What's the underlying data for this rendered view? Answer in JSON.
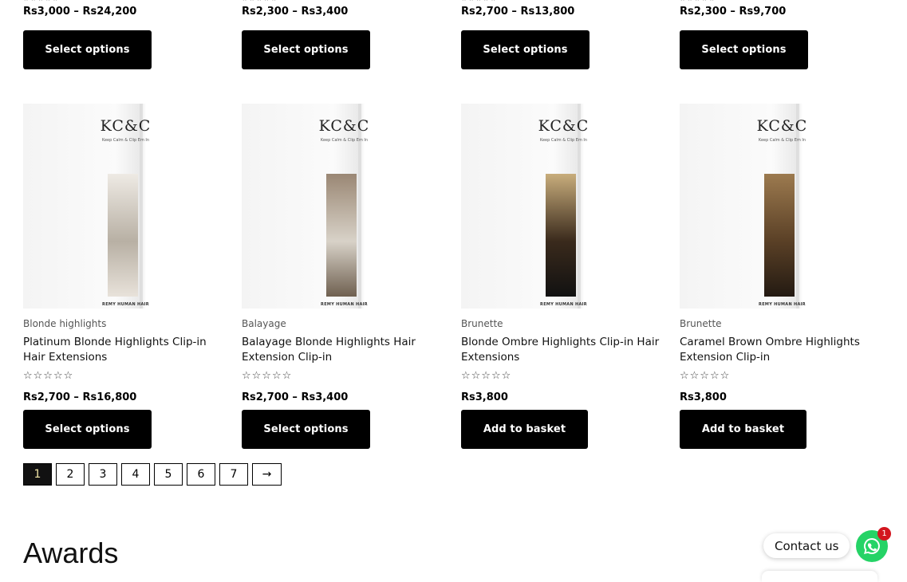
{
  "top_row": [
    {
      "rating": "★★★★★",
      "price_from": "3,000",
      "price_to": "24,200",
      "button": "Select options"
    },
    {
      "rating": "★★★★★",
      "price_from": "2,300",
      "price_to": "3,400",
      "button": "Select options"
    },
    {
      "rating": "★★★★★",
      "price_from": "2,700",
      "price_to": "13,800",
      "button": "Select options"
    },
    {
      "rating": "★★★★★",
      "price_from": "2,300",
      "price_to": "9,700",
      "button": "Select options"
    }
  ],
  "products": [
    {
      "brand": "KC&C",
      "tagline": "Keep Calm & Clip Em In",
      "footer": "REMY HUMAN HAIR",
      "category": "Blonde highlights",
      "title": "Platinum Blonde Highlights Clip-in Hair Extensions",
      "rating": "☆☆☆☆☆",
      "price_from": "2,700",
      "price_to": "16,800",
      "button": "Select options",
      "swatch": [
        "#eeeae4",
        "#b8b0a4",
        "#e8e2da"
      ]
    },
    {
      "brand": "KC&C",
      "tagline": "Keep Calm & Clip Em In",
      "footer": "REMY HUMAN HAIR",
      "category": "Balayage",
      "title": "Balayage Blonde Highlights Hair Extension Clip-in",
      "rating": "☆☆☆☆☆",
      "price_from": "2,700",
      "price_to": "3,400",
      "button": "Select options",
      "swatch": [
        "#9a8774",
        "#d8d2c8",
        "#6f6050"
      ]
    },
    {
      "brand": "KC&C",
      "tagline": "Keep Calm & Clip Em In",
      "footer": "REMY HUMAN HAIR",
      "category": "Brunette",
      "title": "Blonde Ombre Highlights Clip-in Hair Extensions",
      "rating": "☆☆☆☆☆",
      "price_from": "3,800",
      "price_to": "",
      "button": "Add to basket",
      "swatch": [
        "#c8ad7c",
        "#3a2a1c",
        "#111111"
      ]
    },
    {
      "brand": "KC&C",
      "tagline": "Keep Calm & Clip Em In",
      "footer": "REMY HUMAN HAIR",
      "category": "Brunette",
      "title": "Caramel Brown Ombre Highlights Extension Clip-in",
      "rating": "☆☆☆☆☆",
      "price_from": "3,800",
      "price_to": "",
      "button": "Add to basket",
      "swatch": [
        "#9c7a4f",
        "#5a4026",
        "#231a12"
      ]
    }
  ],
  "currency": "Rs",
  "separator": "–",
  "pagination": [
    "1",
    "2",
    "3",
    "4",
    "5",
    "6",
    "7",
    "→"
  ],
  "section_heading": "Awards",
  "contact": {
    "label": "Contact us",
    "badge_count": "1"
  }
}
